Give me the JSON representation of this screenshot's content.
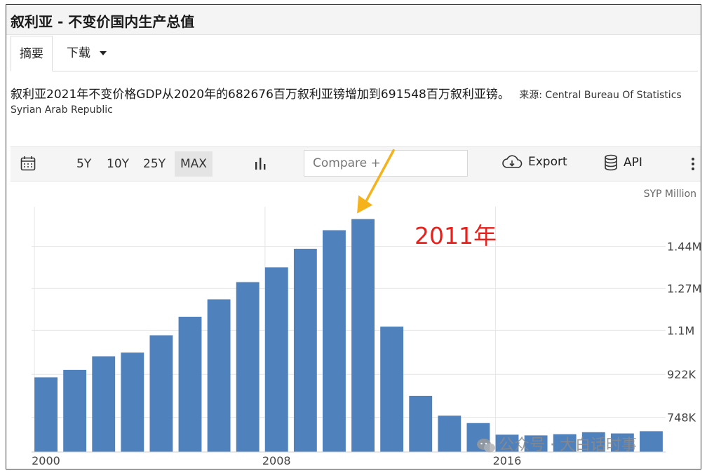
{
  "header": {
    "title": "叙利亚 - 不变价国内生产总值"
  },
  "tabs": {
    "summary": "摘要",
    "download": "下载"
  },
  "summary": {
    "text": "叙利亚2021年不变价格GDP从2020年的682676百万叙利亚镑增加到691548百万叙利亚镑。",
    "source": "来源: Central Bureau Of Statistics",
    "country": "Syrian Arab Republic"
  },
  "toolbar": {
    "ranges": [
      "5Y",
      "10Y",
      "25Y",
      "MAX"
    ],
    "selected_range": "MAX",
    "compare_placeholder": "Compare +",
    "export_label": "Export",
    "api_label": "API"
  },
  "icons": {
    "calendar": "calendar-icon",
    "chart_type": "bar-chart-icon",
    "export": "cloud-download-icon",
    "api": "database-icon",
    "more": "more-vertical-icon"
  },
  "colors": {
    "bar": "#4f81bd",
    "annotation_text": "#e8211c",
    "annotation_arrow": "#f6b21b"
  },
  "chart_data": {
    "type": "bar",
    "unit_label": "SYP Million",
    "x": [
      2000,
      2001,
      2002,
      2003,
      2004,
      2005,
      2006,
      2007,
      2008,
      2009,
      2010,
      2011,
      2012,
      2013,
      2014,
      2015,
      2016,
      2017,
      2018,
      2019,
      2020,
      2021
    ],
    "values": [
      910000,
      940000,
      995000,
      1010000,
      1080000,
      1155000,
      1225000,
      1295000,
      1355000,
      1430000,
      1505000,
      1550000,
      1115000,
      835000,
      755000,
      725000,
      678000,
      675000,
      680000,
      688000,
      683000,
      692000
    ],
    "ytick_values": [
      748000,
      922000,
      1100000,
      1270000,
      1440000
    ],
    "ytick_labels": [
      "748K",
      "922K",
      "1.1M",
      "1.27M",
      "1.44M"
    ],
    "xtick_values": [
      2000,
      2008,
      2016
    ],
    "xtick_labels": [
      "2000",
      "2008",
      "2016"
    ],
    "ylim": [
      608000,
      1600000
    ],
    "y_axis_side": "right",
    "grid": true,
    "annotation": {
      "text": "2011年",
      "target_x": 2011
    }
  },
  "watermark": {
    "text": "公众号 · 大白话时事"
  }
}
